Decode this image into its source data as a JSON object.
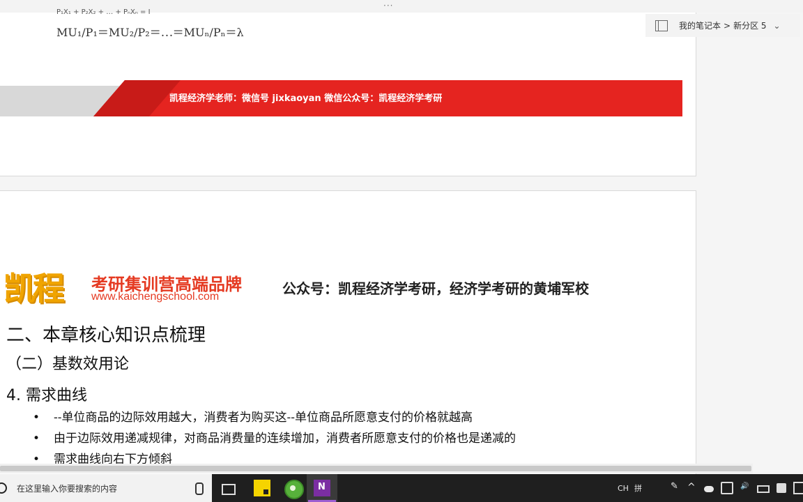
{
  "window": {
    "drag_handle": "···"
  },
  "breadcrumb": {
    "notebook": "我的笔记本",
    "separator": ">",
    "section": "新分区 5"
  },
  "page1": {
    "formula_partial": "P₁X₁ + P₂X₂ + … + PₙXₙ = I",
    "formula": "MU₁/P₁＝MU₂/P₂＝⋯＝MUₙ/Pₙ＝λ",
    "banner_text": "凯程经济学老师：微信号 jixkaoyan   微信公众号：凯程经济学考研",
    "banner_colors": {
      "red": "#e52420",
      "gray": "#d9d9d9"
    }
  },
  "page2": {
    "logo_text": "凯程",
    "slogan": "考研集训营高端品牌",
    "site": "www.kaichengschool.com",
    "public_account": "公众号：凯程经济学考研，经济学考研的黄埔军校",
    "heading_1": "二、本章核心知识点梳理",
    "heading_2": "（二）基数效用论",
    "heading_3": "4. 需求曲线",
    "bullets": [
      "--单位商品的边际效用越大，消费者为购买这--单位商品所愿意支付的价格就越高",
      "由于边际效用递减规律，对商品消费量的连续增加，消费者所愿意支付的价格也是递减的",
      "需求曲线向右下方倾斜"
    ]
  },
  "taskbar": {
    "search_placeholder": "在这里输入你要搜索的内容",
    "ime_lang": "CH",
    "ime_mode": "拼",
    "apps": [
      "task-view",
      "sticky-notes",
      "browser",
      "onenote"
    ],
    "onenote_letter": "N"
  }
}
